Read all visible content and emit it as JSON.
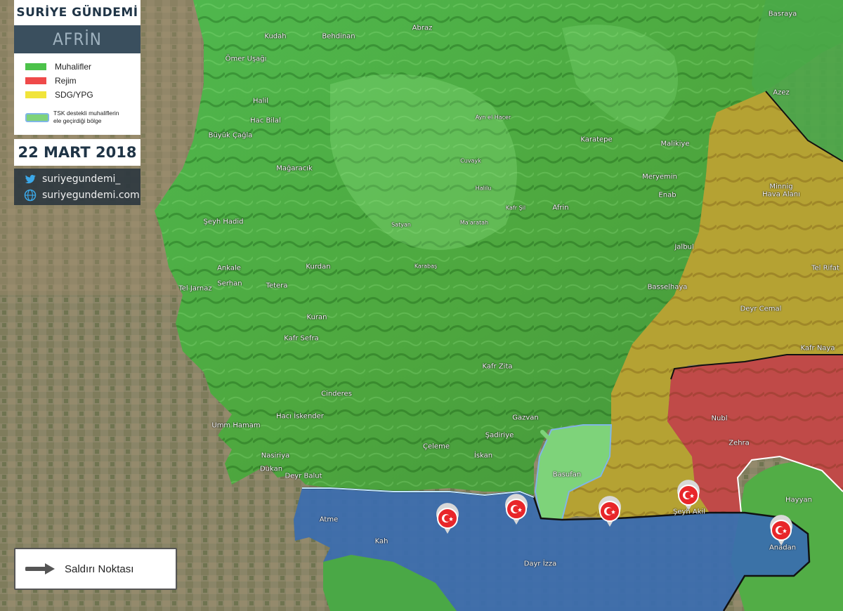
{
  "legend": {
    "brand": "SURİYE GÜNDEMİ",
    "region": "AFRİN",
    "items": [
      {
        "label": "Muhalifler",
        "color": "#4cc24a"
      },
      {
        "label": "Rejim",
        "color": "#ef4a4a"
      },
      {
        "label": "SDG/YPG",
        "color": "#f1e43a"
      }
    ],
    "tsk_line1": "TSK destekli muhaliflerin",
    "tsk_line2": "ele geçirdiği bölge",
    "date": "22 MART 2018",
    "twitter": "suriyegundemi_",
    "website": "suriyegundemi.com"
  },
  "attack_legend": "Saldırı Noktası",
  "places": [
    {
      "name": "Kudah"
    },
    {
      "name": "Behdinan"
    },
    {
      "name": "Abraz"
    },
    {
      "name": "Basraya"
    },
    {
      "name": "Ömer Uşağı"
    },
    {
      "name": "Azez"
    },
    {
      "name": "Halil"
    },
    {
      "name": "Hac Bilal"
    },
    {
      "name": "Ayn el Hacer"
    },
    {
      "name": "Büyük Çağla"
    },
    {
      "name": "Karatepe"
    },
    {
      "name": "Malikiye"
    },
    {
      "name": "Cuvayk"
    },
    {
      "name": "Mağaracık"
    },
    {
      "name": "Meryemin"
    },
    {
      "name": "Halilu"
    },
    {
      "name": "Enab"
    },
    {
      "name": "Minnig"
    },
    {
      "name": "Hava Alanı"
    },
    {
      "name": "Kafr Şil"
    },
    {
      "name": "Afrin"
    },
    {
      "name": "Şeyh Hadid"
    },
    {
      "name": "Satyan"
    },
    {
      "name": "Ma'aratah"
    },
    {
      "name": "Jalbul"
    },
    {
      "name": "Ankale"
    },
    {
      "name": "Kurdan"
    },
    {
      "name": "Karabaş"
    },
    {
      "name": "Tel Rifat"
    },
    {
      "name": "Serhan"
    },
    {
      "name": "Tel Jarnaz"
    },
    {
      "name": "Tetera"
    },
    {
      "name": "Basselhaya"
    },
    {
      "name": "Deyr Cemal"
    },
    {
      "name": "Kuran"
    },
    {
      "name": "Kafr Sefra"
    },
    {
      "name": "Kafr Naya"
    },
    {
      "name": "Kafr Zita"
    },
    {
      "name": "Cinderes"
    },
    {
      "name": "Hacı İskender"
    },
    {
      "name": "Gazvan"
    },
    {
      "name": "Umm Hamam"
    },
    {
      "name": "Nubl"
    },
    {
      "name": "Şadiriye"
    },
    {
      "name": "Çeleme"
    },
    {
      "name": "Zehra"
    },
    {
      "name": "Nasiriya"
    },
    {
      "name": "İskan"
    },
    {
      "name": "Basufan"
    },
    {
      "name": "Dukan"
    },
    {
      "name": "Deyr Balut"
    },
    {
      "name": "Hayyan"
    },
    {
      "name": "Şeyh Akil"
    },
    {
      "name": "Atme"
    },
    {
      "name": "Kah"
    },
    {
      "name": "Anadan"
    },
    {
      "name": "Dayr İzza"
    }
  ],
  "map_colors": {
    "opposition": "#4cc24a",
    "regime": "#ef4a4a",
    "sdg_ypg": "#f1e43a",
    "tsk_area": "#7ed37a",
    "turkey_controlled": "#3f78c8",
    "marker": "#e8262a"
  },
  "attack_markers": [
    {
      "icon": "turkish-flag-marker"
    },
    {
      "icon": "turkish-flag-marker"
    },
    {
      "icon": "turkish-flag-marker"
    },
    {
      "icon": "turkish-flag-marker"
    },
    {
      "icon": "turkish-flag-marker"
    }
  ]
}
